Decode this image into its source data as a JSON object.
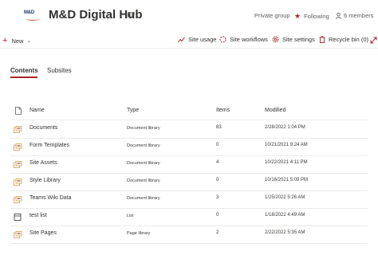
{
  "header": {
    "logo_text": "M&D",
    "site_title": "M&D Digital Hub",
    "group_privacy": "Private group",
    "follow_label": "Following",
    "members_label": "6 members"
  },
  "command_bar": {
    "new_label": "New",
    "site_usage": "Site usage",
    "site_workflows": "Site workflows",
    "site_settings": "Site settings",
    "recycle_bin": "Recycle bin (0)"
  },
  "tabs": [
    {
      "label": "Contents",
      "active": true
    },
    {
      "label": "Subsites",
      "active": false
    }
  ],
  "table": {
    "columns": {
      "name": "Name",
      "type": "Type",
      "items": "Items",
      "modified": "Modified"
    },
    "rows": [
      {
        "name": "Documents",
        "type": "Document library",
        "items": "83",
        "modified": "2/28/2022 1:04 PM",
        "icon": "library-icon"
      },
      {
        "name": "Form Templates",
        "type": "Document library",
        "items": "0",
        "modified": "10/21/2021 9:24 AM",
        "icon": "library-icon"
      },
      {
        "name": "Site Assets",
        "type": "Document library",
        "items": "4",
        "modified": "10/22/2021 4:11 PM",
        "icon": "library-icon"
      },
      {
        "name": "Style Library",
        "type": "Document library",
        "items": "0",
        "modified": "10/16/2021 5:09 PM",
        "icon": "library-icon"
      },
      {
        "name": "Teams Wiki Data",
        "type": "Document library",
        "items": "3",
        "modified": "1/25/2022 5:26 AM",
        "icon": "library-icon"
      },
      {
        "name": "test list",
        "type": "List",
        "items": "0",
        "modified": "1/18/2022 4:49 AM",
        "icon": "list-icon"
      },
      {
        "name": "Site Pages",
        "type": "Page library",
        "items": "2",
        "modified": "2/22/2022 5:35 AM",
        "icon": "library-icon"
      }
    ]
  },
  "colors": {
    "accent": "#a4262c",
    "brand_blue": "#1b3a6b",
    "brand_orange": "#e05a2a"
  }
}
